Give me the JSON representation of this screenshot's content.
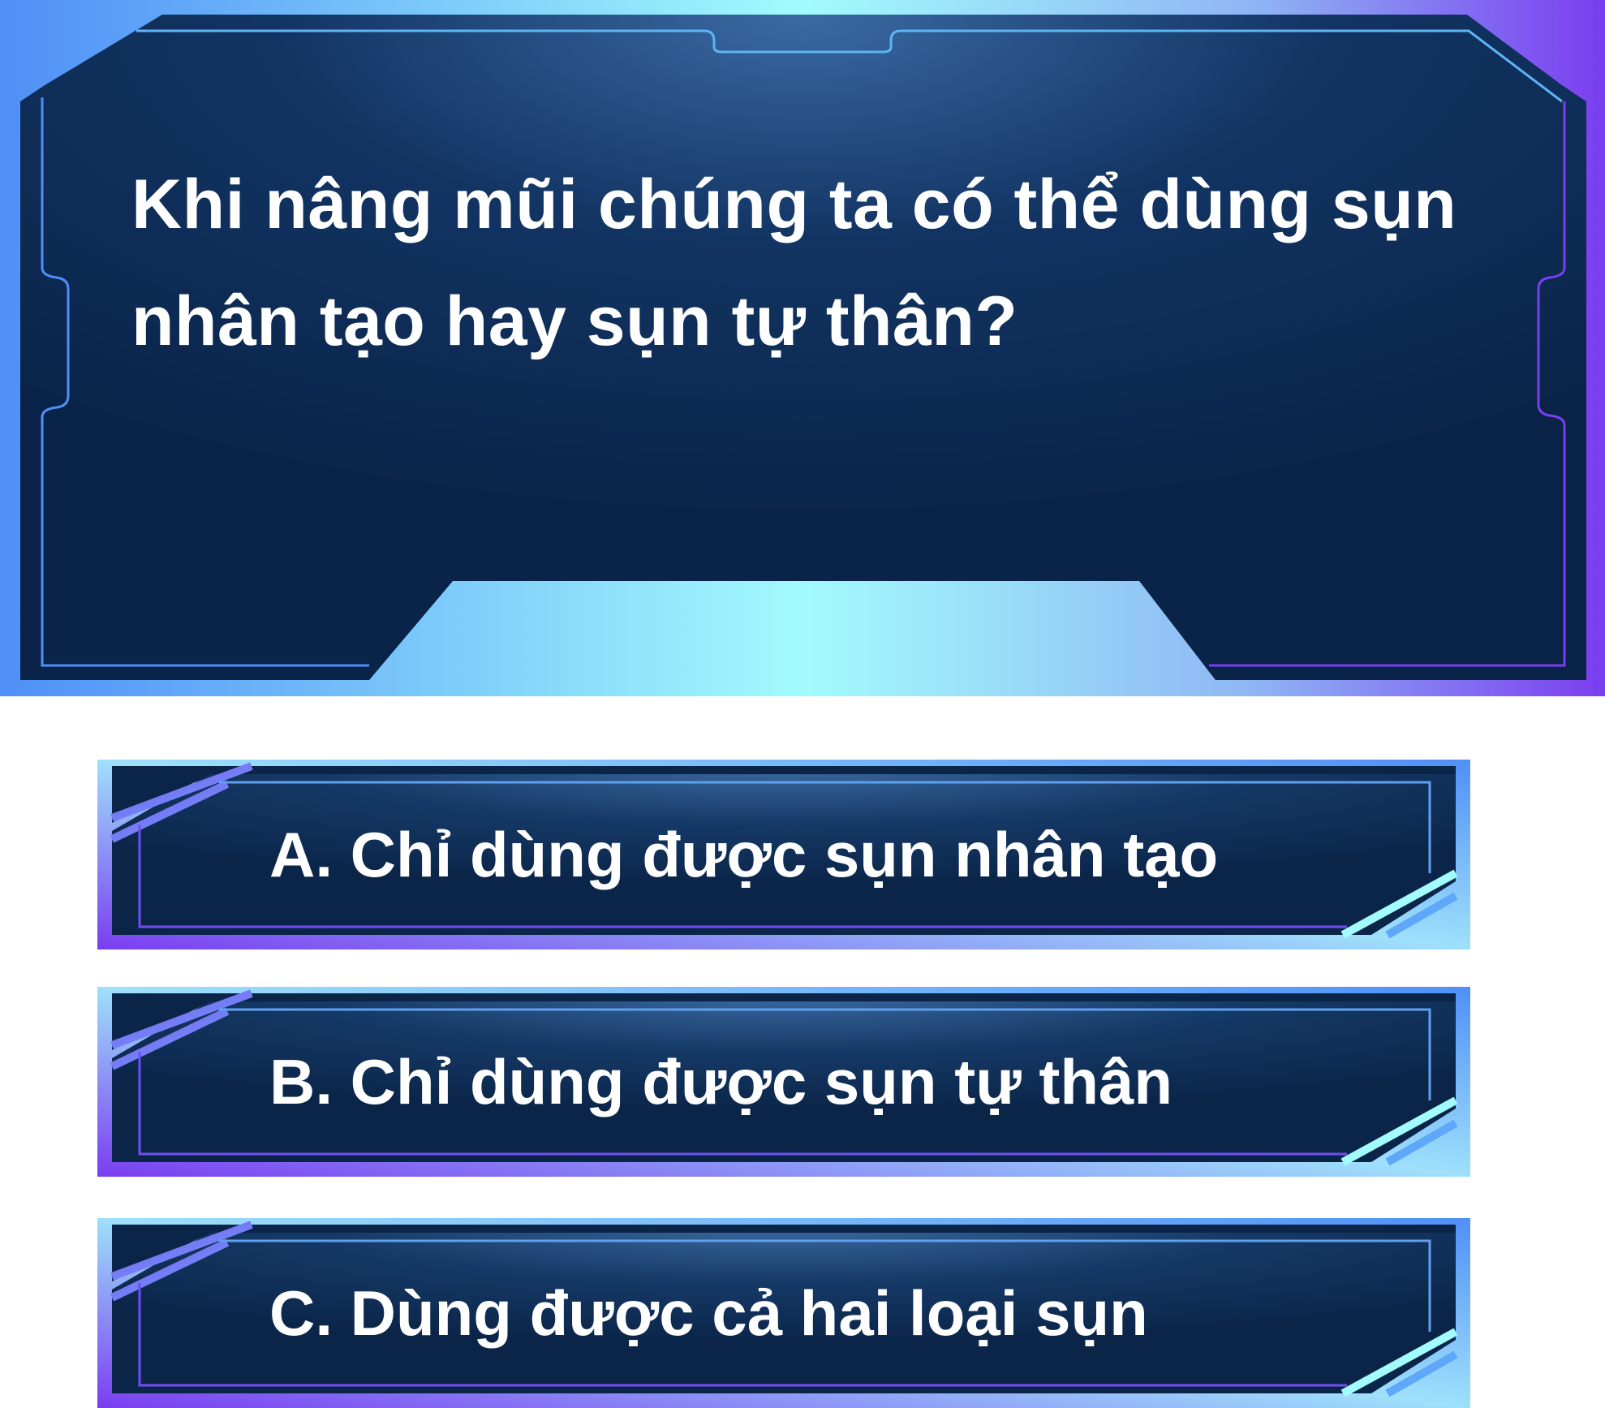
{
  "question": {
    "text": "Khi nâng mũi chúng ta có thể dùng sụn nhân tạo hay sụn tự thân?"
  },
  "answers": [
    {
      "label": "A. Chỉ dùng được sụn nhân tạo"
    },
    {
      "label": "B. Chỉ dùng được sụn tự thân"
    },
    {
      "label": "C. Dùng được cả hai loại sụn"
    }
  ],
  "colors": {
    "panel_fill": "#0a2449",
    "panel_glow": "#2e5a8f",
    "frame_blue": "#4f8ff7",
    "frame_cyan": "#a2fbfc",
    "frame_purple": "#7a3df0",
    "text": "#ffffff"
  }
}
